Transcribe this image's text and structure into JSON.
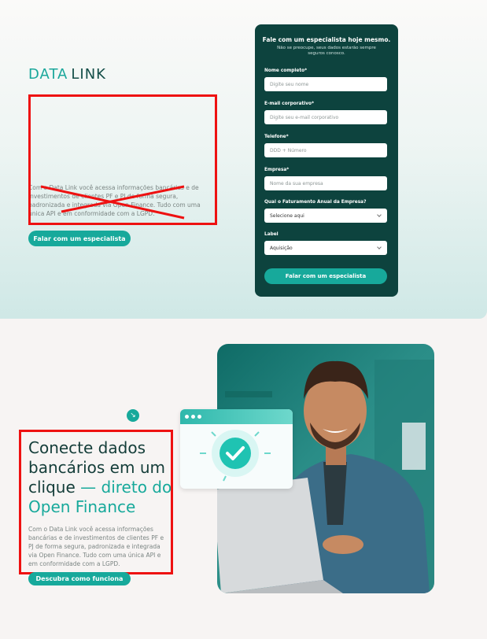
{
  "brand": {
    "part1": "DATA",
    "part2": "LINK"
  },
  "hero": {
    "description": "Com o Data Link você acessa informações bancárias e de investimentos de clientes PF e PJ de forma segura, padronizada e integrada via Open Finance. Tudo com uma única API e em conformidade com a LGPD.",
    "cta": "Falar com um especialista"
  },
  "form": {
    "title": "Fale com um especialista hoje mesmo.",
    "subtitle": "Não se preocupe, seus dados estarão sempre seguros conosco.",
    "fields": [
      {
        "label": "Nome completo*",
        "placeholder": "Digite seu nome"
      },
      {
        "label": "E-mail corporativo*",
        "placeholder": "Digite seu e-mail corporativo"
      },
      {
        "label": "Telefone*",
        "placeholder": "DDD + Número"
      },
      {
        "label": "Empresa*",
        "placeholder": "Nome da sua empresa"
      },
      {
        "label": "Qual o Faturamento Anual da Empresa?",
        "value": "Selecione aqui"
      },
      {
        "label": "Label",
        "value": "Aquisição"
      }
    ],
    "submit": "Falar com um especialista"
  },
  "section2": {
    "arrow": "↘",
    "title_main": "Conecte dados bancários em um clique",
    "title_accent": " — direto do Open Finance",
    "description": "Com o Data Link você acessa informações bancárias e de investimentos de clientes PF e PJ de forma segura, padronizada e integrada via Open Finance. Tudo com uma única API e em conformidade com a LGPD.",
    "cta": "Descubra como funciona"
  },
  "colors": {
    "primary": "#17a99b",
    "dark": "#0d433e",
    "annotation": "#e11111"
  }
}
